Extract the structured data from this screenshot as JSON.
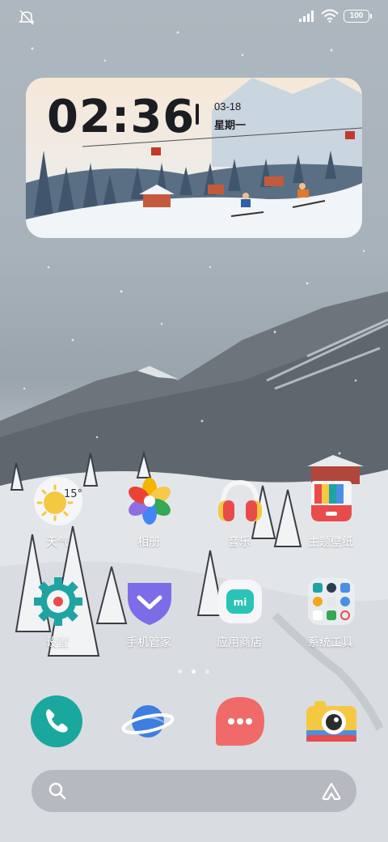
{
  "status_bar": {
    "icons": [
      "mute-icon",
      "signal-icon",
      "wifi-icon",
      "battery-icon"
    ],
    "battery_level": "100"
  },
  "widget": {
    "time": "02:36",
    "date": "03-18",
    "weekday": "星期一"
  },
  "apps": [
    {
      "label": "天气",
      "icon": "weather-icon",
      "badge": "15°"
    },
    {
      "label": "相册",
      "icon": "gallery-icon"
    },
    {
      "label": "音乐",
      "icon": "music-icon"
    },
    {
      "label": "主题壁纸",
      "icon": "themes-icon"
    },
    {
      "label": "设置",
      "icon": "settings-icon"
    },
    {
      "label": "手机管家",
      "icon": "security-icon"
    },
    {
      "label": "应用商店",
      "icon": "app-store-icon"
    },
    {
      "label": "系统工具",
      "icon": "system-tools-folder-icon"
    }
  ],
  "dock": [
    {
      "icon": "phone-icon"
    },
    {
      "icon": "browser-icon"
    },
    {
      "icon": "messages-icon"
    },
    {
      "icon": "camera-icon"
    }
  ],
  "page_indicator": {
    "pages": 3,
    "current": 2
  },
  "colors": {
    "phone": "#1aa89e",
    "messages": "#f06a6a",
    "security": "#7c6ce8",
    "settings": "#1fa3a3"
  }
}
